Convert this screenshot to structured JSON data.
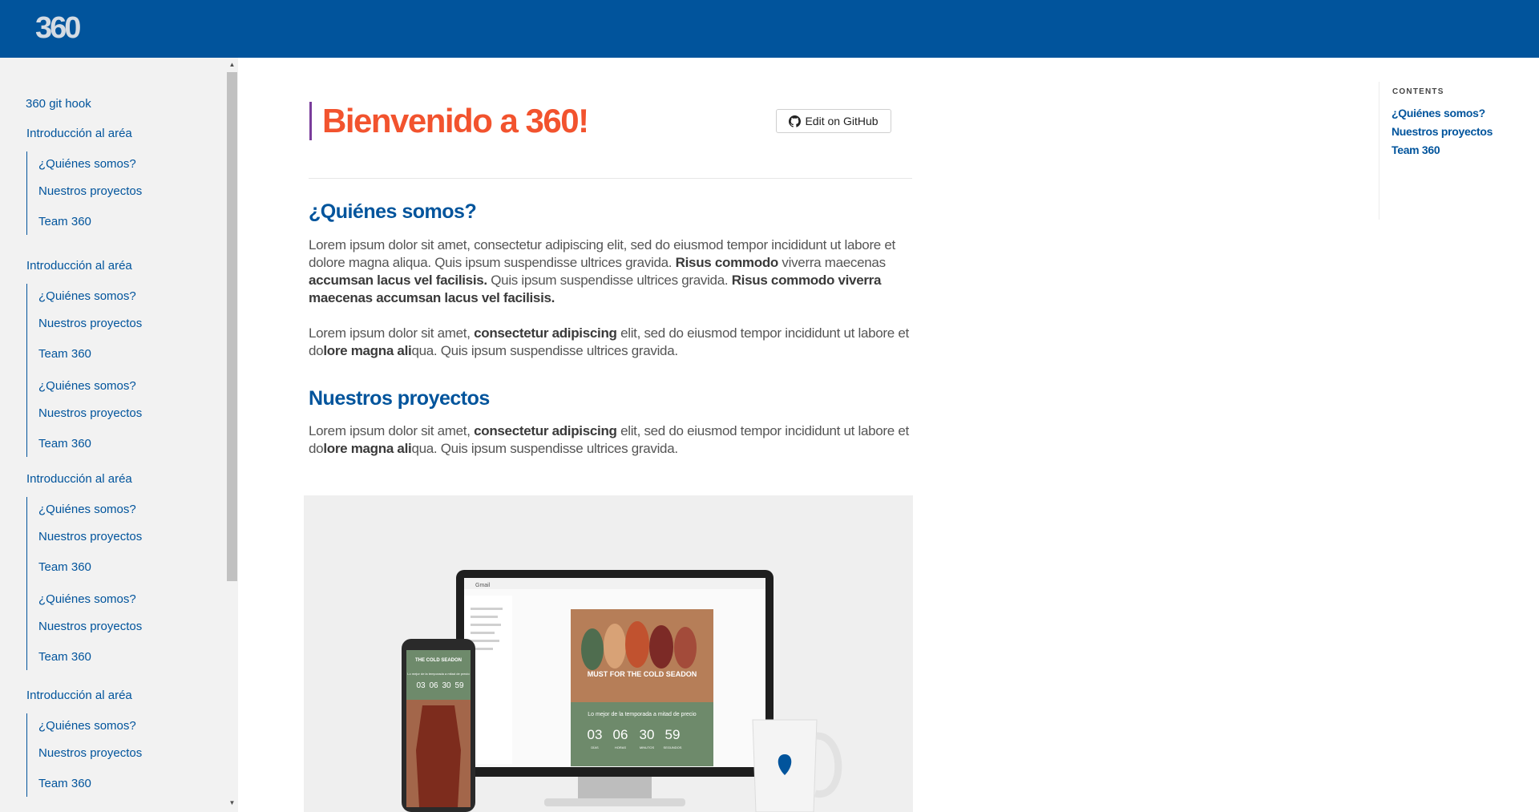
{
  "header": {
    "logo_text": "360",
    "brand_color": "#01549c"
  },
  "sidebar": {
    "top_link": "360 git hook",
    "groups": [
      {
        "title": "Introducción al aréa",
        "items": [
          "¿Quiénes somos?",
          "Nuestros proyectos",
          "Team 360"
        ]
      },
      {
        "title": "Introducción al aréa",
        "items": [
          "¿Quiénes somos?",
          "Nuestros proyectos",
          "Team 360",
          "¿Quiénes somos?",
          "Nuestros proyectos",
          "Team 360"
        ]
      },
      {
        "title": "Introducción al aréa",
        "items": [
          "¿Quiénes somos?",
          "Nuestros proyectos",
          "Team 360",
          "¿Quiénes somos?",
          "Nuestros proyectos",
          "Team 360"
        ]
      },
      {
        "title": "Introducción al aréa",
        "items": [
          "¿Quiénes somos?",
          "Nuestros proyectos",
          "Team 360"
        ]
      }
    ]
  },
  "main": {
    "title": "Bienvenido a 360!",
    "title_color": "#f2532e",
    "edit_button": "Edit on GitHub",
    "sections": [
      {
        "heading": "¿Quiénes somos?",
        "paragraphs": [
          [
            {
              "t": "Lorem ipsum dolor sit amet, consectetur adipiscing elit, sed do eiusmod tempor incididunt ut labore et dolore magna aliqua. Quis ipsum suspendisse ultrices gravida. ",
              "b": false
            },
            {
              "t": "Risus commodo",
              "b": true
            },
            {
              "t": " viverra maecenas ",
              "b": false
            },
            {
              "t": "accumsan lacus vel facilisis.",
              "b": true
            },
            {
              "t": "  Quis ipsum suspendisse ultrices gravida. ",
              "b": false
            },
            {
              "t": "Risus commodo viverra maecenas accumsan lacus vel facilisis.",
              "b": true
            }
          ],
          [
            {
              "t": "Lorem ipsum dolor sit amet, ",
              "b": false
            },
            {
              "t": "consectetur adipiscing",
              "b": true
            },
            {
              "t": " elit, sed do eiusmod tempor incididunt ut labore et do",
              "b": false
            },
            {
              "t": "lore magna ali",
              "b": true
            },
            {
              "t": "qua. Quis ipsum suspendisse ultrices gravida.",
              "b": false
            }
          ]
        ]
      },
      {
        "heading": "Nuestros proyectos",
        "paragraphs": [
          [
            {
              "t": "Lorem ipsum dolor sit amet, ",
              "b": false
            },
            {
              "t": "consectetur adipiscing",
              "b": true
            },
            {
              "t": " elit, sed do eiusmod tempor incididunt ut labore et do",
              "b": false
            },
            {
              "t": "lore magna ali",
              "b": true
            },
            {
              "t": "qua. Quis ipsum suspendisse ultrices gravida.",
              "b": false
            }
          ]
        ]
      }
    ],
    "image": {
      "email_banner": "MUST FOR THE COLD SEADON",
      "email_subtext": "Lo mejor de la temporada a mitad de precio",
      "countdown": [
        "03",
        "06",
        "30",
        "59"
      ],
      "countdown_labels": [
        "DÍAS",
        "HORAS",
        "MINUTOS",
        "SEGUNDOS"
      ],
      "phone_banner": "THE COLD SEADON",
      "phone_subtext": "Lo mejor de la temporada a mitad de precio",
      "gmail_label": "Gmail"
    }
  },
  "toc": {
    "label": "CONTENTS",
    "items": [
      "¿Quiénes somos?",
      "Nuestros proyectos",
      "Team 360"
    ]
  }
}
